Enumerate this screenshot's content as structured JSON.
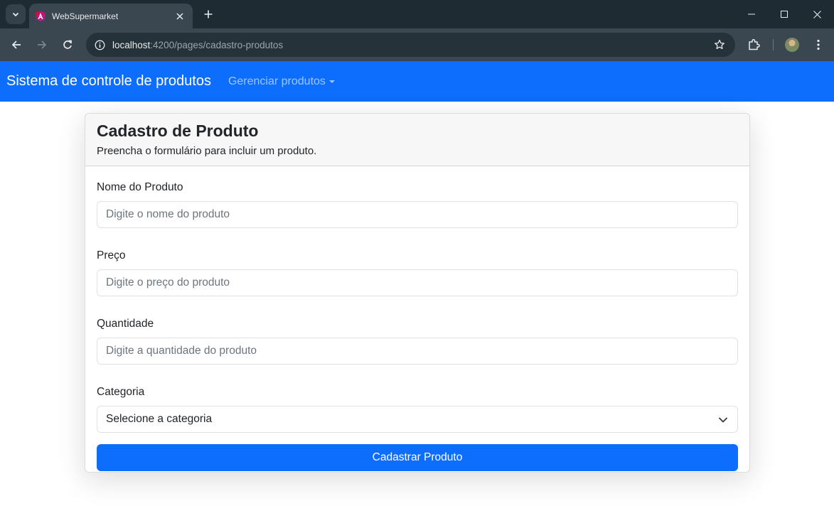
{
  "browser": {
    "tab_title": "WebSupermarket",
    "url_host": "localhost",
    "url_rest": ":4200/pages/cadastro-produtos"
  },
  "navbar": {
    "brand": "Sistema de controle de produtos",
    "dropdown_label": "Gerenciar produtos"
  },
  "card": {
    "title": "Cadastro de Produto",
    "subtitle": "Preencha o formulário para incluir um produto."
  },
  "form": {
    "name_label": "Nome do Produto",
    "name_placeholder": "Digite o nome do produto",
    "price_label": "Preço",
    "price_placeholder": "Digite o preço do produto",
    "quantity_label": "Quantidade",
    "quantity_placeholder": "Digite a quantidade do produto",
    "category_label": "Categoria",
    "category_selected": "Selecione a categoria",
    "submit_label": "Cadastrar Produto"
  },
  "colors": {
    "primary": "#0d6efd",
    "chrome_dark": "#1f2b33",
    "chrome_toolbar": "#3a4650"
  },
  "icons": [
    "tab-search-icon",
    "angular-favicon-icon",
    "close-icon",
    "plus-icon",
    "minimize-icon",
    "maximize-icon",
    "close-window-icon",
    "back-icon",
    "forward-icon",
    "reload-icon",
    "info-icon",
    "star-icon",
    "extensions-icon",
    "more-icon",
    "chevron-down-icon"
  ]
}
